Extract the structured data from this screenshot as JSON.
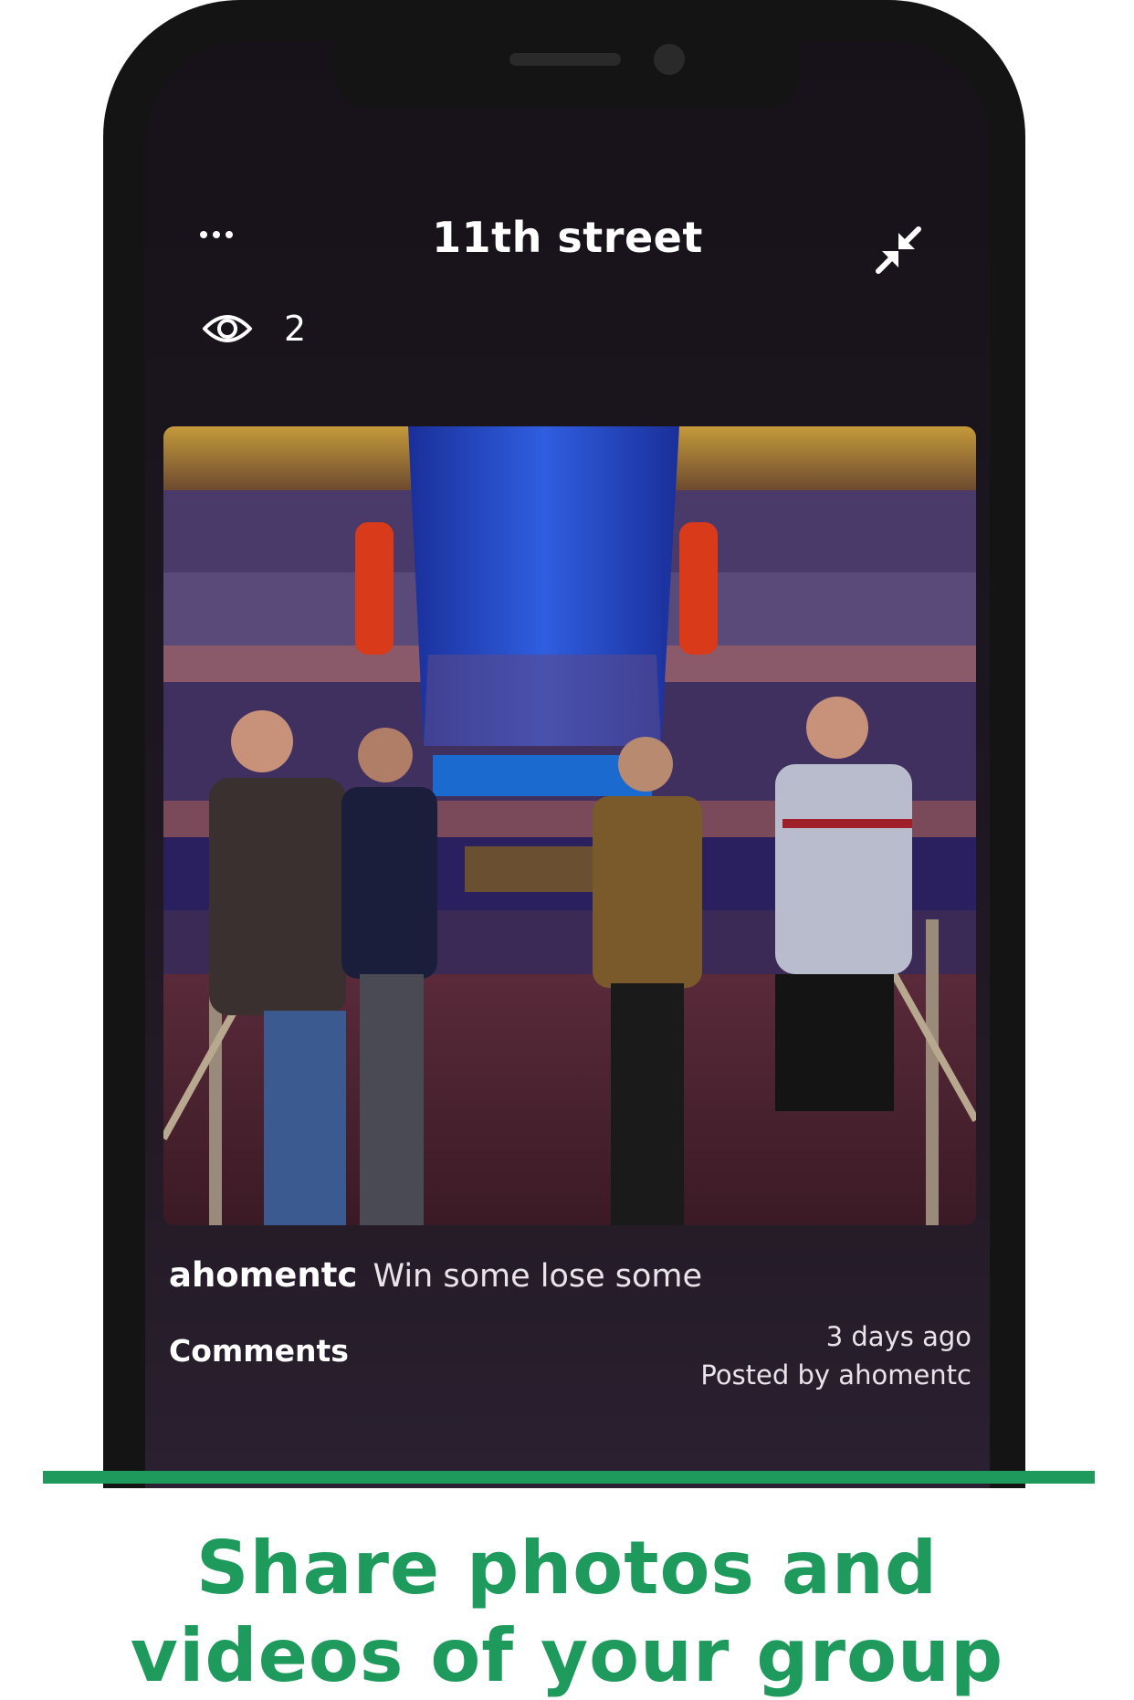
{
  "header": {
    "title": "11th  street",
    "more_icon": "ellipsis-icon",
    "collapse_icon": "collapse-arrows-icon"
  },
  "views": {
    "icon": "eye-icon",
    "count": "2"
  },
  "post": {
    "username": "ahomentc",
    "caption": "Win some lose some",
    "comments_label": "Comments",
    "time_ago": "3 days ago",
    "posted_by": "Posted by ahomentc"
  },
  "promo": {
    "line1": "Share photos and",
    "line2": "videos of your group"
  },
  "colors": {
    "accent_green": "#1e9a5c",
    "screen_bg": "#1c1620",
    "frame": "#141414"
  }
}
